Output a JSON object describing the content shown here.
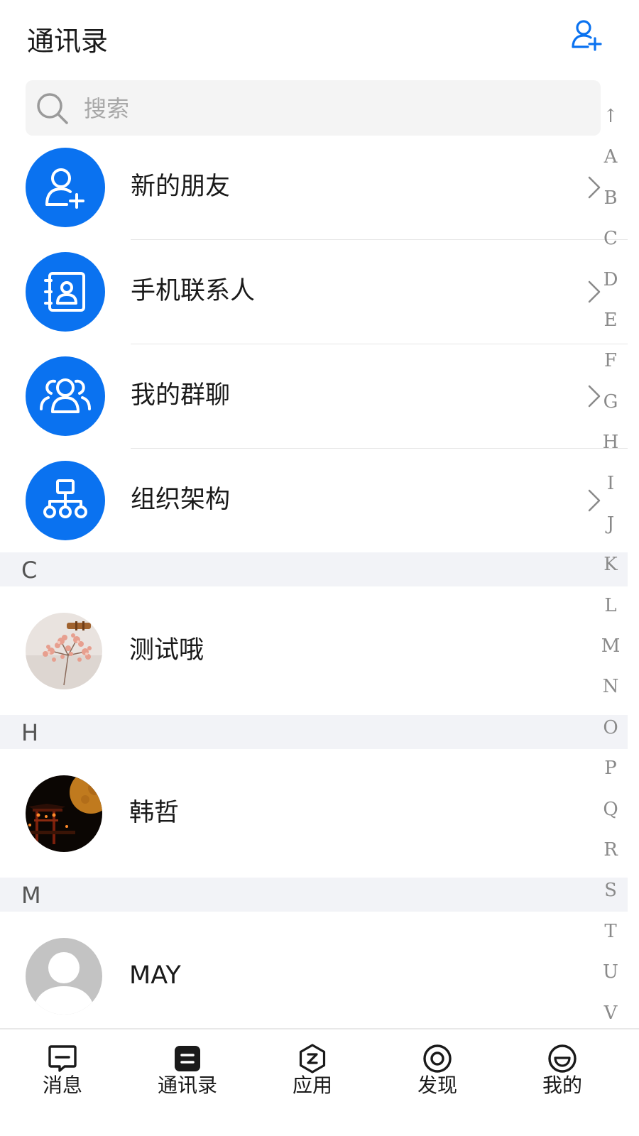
{
  "header": {
    "title": "通讯录",
    "add_icon": "add-user-icon"
  },
  "search": {
    "placeholder": "搜索",
    "icon": "search-icon"
  },
  "functions": [
    {
      "label": "新的朋友",
      "icon": "new-friend-icon"
    },
    {
      "label": "手机联系人",
      "icon": "phone-contacts-icon"
    },
    {
      "label": "我的群聊",
      "icon": "group-chat-icon"
    },
    {
      "label": "组织架构",
      "icon": "org-structure-icon"
    }
  ],
  "sections": [
    {
      "letter": "C",
      "contacts": [
        {
          "name": "测试哦"
        }
      ]
    },
    {
      "letter": "H",
      "contacts": [
        {
          "name": "韩哲"
        }
      ]
    },
    {
      "letter": "M",
      "contacts": [
        {
          "name": "MAY"
        }
      ]
    }
  ],
  "index_bar": [
    "↑",
    "A",
    "B",
    "C",
    "D",
    "E",
    "F",
    "G",
    "H",
    "I",
    "J",
    "K",
    "L",
    "M",
    "N",
    "O",
    "P",
    "Q",
    "R",
    "S",
    "T",
    "U",
    "V"
  ],
  "tabs": [
    {
      "label": "消息",
      "icon": "message-icon"
    },
    {
      "label": "通讯录",
      "icon": "contacts-icon",
      "active": true
    },
    {
      "label": "应用",
      "icon": "apps-icon"
    },
    {
      "label": "发现",
      "icon": "discover-icon"
    },
    {
      "label": "我的",
      "icon": "profile-icon"
    }
  ],
  "colors": {
    "accent": "#0a72f0",
    "section_bg": "#f2f3f7",
    "search_bg": "#f4f4f4"
  }
}
